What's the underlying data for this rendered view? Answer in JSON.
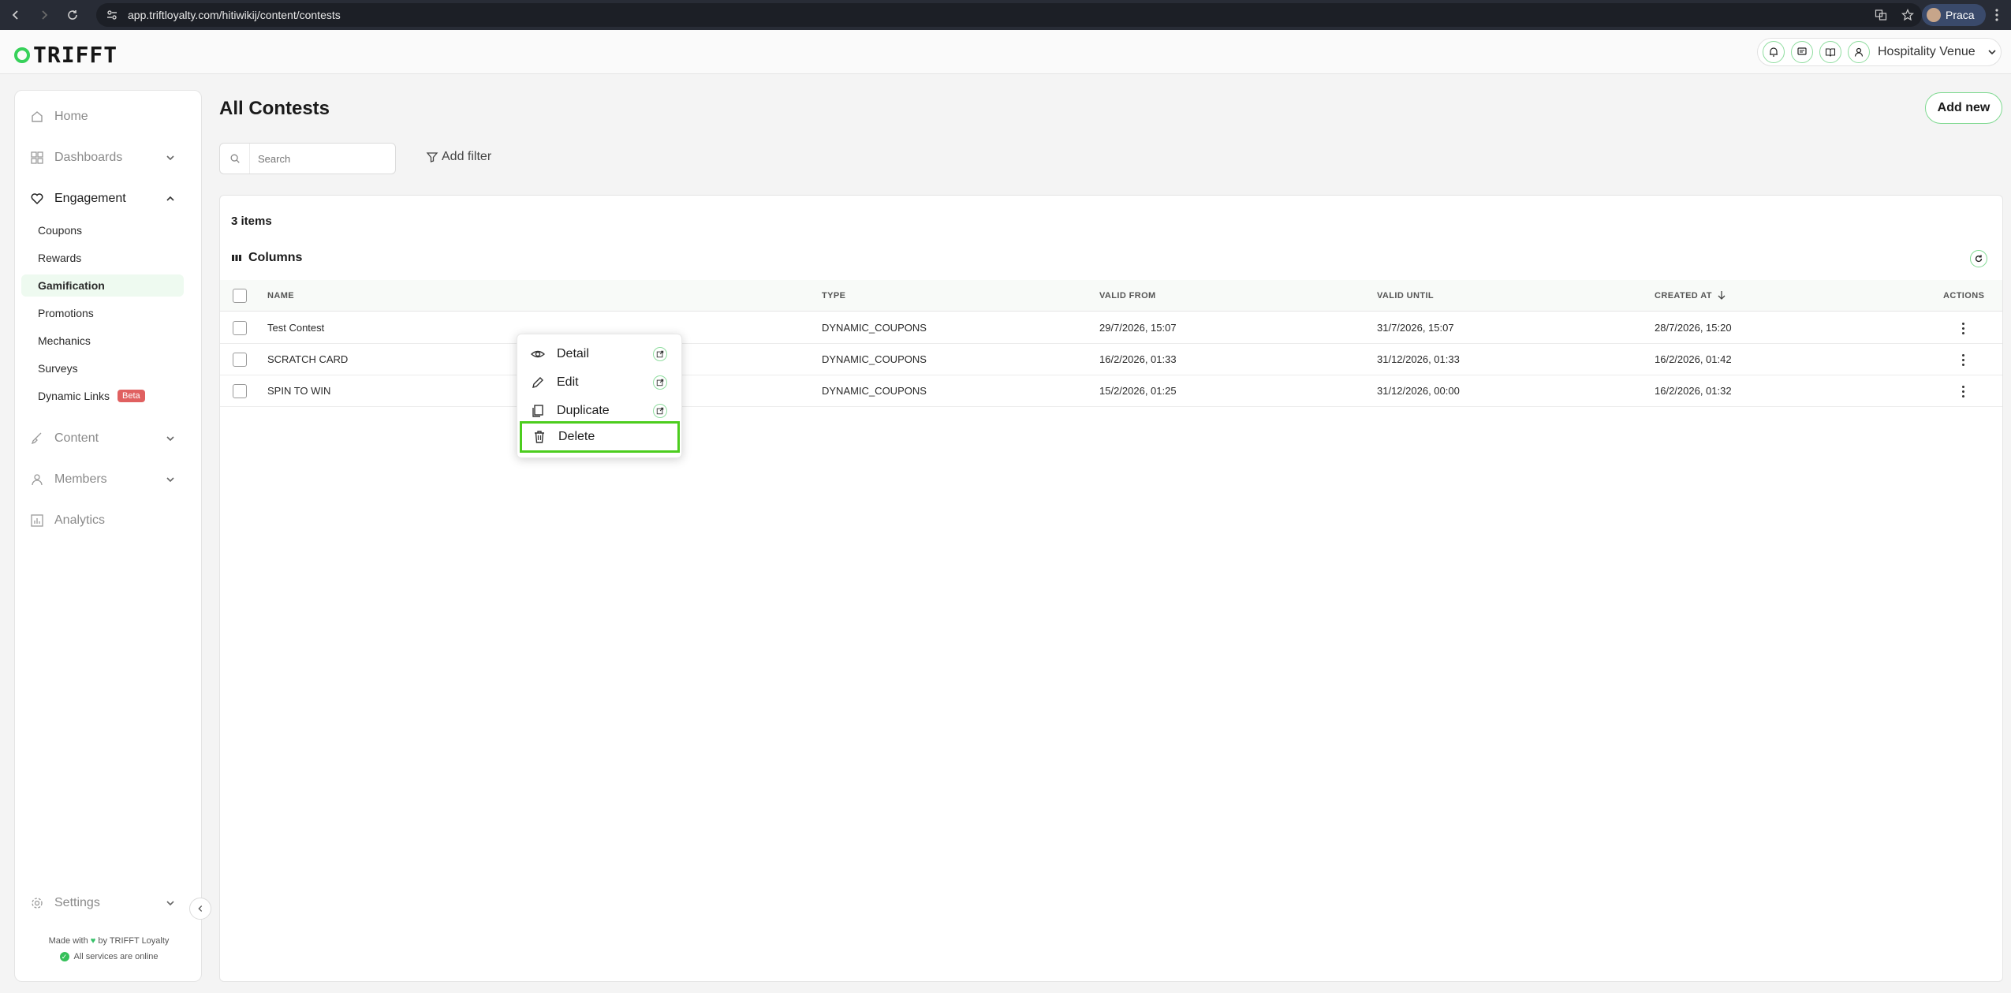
{
  "browser": {
    "url": "app.triftloyalty.com/hitiwikij/content/contests",
    "profile_name": "Praca"
  },
  "header": {
    "logo_text": "TRIFFT",
    "venue": "Hospitality Venue"
  },
  "sidebar": {
    "items": [
      {
        "label": "Home",
        "icon": "home-icon"
      },
      {
        "label": "Dashboards",
        "icon": "dashboard-icon"
      },
      {
        "label": "Engagement",
        "icon": "heart-icon"
      },
      {
        "label": "Content",
        "icon": "brush-icon"
      },
      {
        "label": "Members",
        "icon": "user-icon"
      },
      {
        "label": "Analytics",
        "icon": "chart-icon"
      }
    ],
    "engagement_children": [
      {
        "label": "Coupons"
      },
      {
        "label": "Rewards"
      },
      {
        "label": "Gamification"
      },
      {
        "label": "Promotions"
      },
      {
        "label": "Mechanics"
      },
      {
        "label": "Surveys"
      },
      {
        "label": "Dynamic Links",
        "badge": "Beta"
      }
    ],
    "settings_label": "Settings",
    "footer_made_with": "Made with",
    "footer_by": "by TRIFFT Loyalty",
    "footer_status": "All services are online"
  },
  "main": {
    "title": "All Contests",
    "add_new_label": "Add new",
    "search_placeholder": "Search",
    "add_filter_label": "Add filter",
    "items_count": "3 items",
    "columns_label": "Columns",
    "columns": {
      "name": "NAME",
      "type": "TYPE",
      "valid_from": "VALID FROM",
      "valid_until": "VALID UNTIL",
      "created_at": "CREATED AT",
      "actions": "ACTIONS"
    },
    "rows": [
      {
        "name": "Test Contest",
        "type": "DYNAMIC_COUPONS",
        "valid_from": "29/7/2026, 15:07",
        "valid_until": "31/7/2026, 15:07",
        "created_at": "28/7/2026, 15:20"
      },
      {
        "name": "SCRATCH CARD",
        "type": "DYNAMIC_COUPONS",
        "valid_from": "16/2/2026, 01:33",
        "valid_until": "31/12/2026, 01:33",
        "created_at": "16/2/2026, 01:42"
      },
      {
        "name": "SPIN TO WIN",
        "type": "DYNAMIC_COUPONS",
        "valid_from": "15/2/2026, 01:25",
        "valid_until": "31/12/2026, 00:00",
        "created_at": "16/2/2026, 01:32"
      }
    ]
  },
  "context_menu": {
    "items": [
      {
        "label": "Detail",
        "icon": "eye-icon"
      },
      {
        "label": "Edit",
        "icon": "pencil-icon"
      },
      {
        "label": "Duplicate",
        "icon": "copy-icon"
      },
      {
        "label": "Delete",
        "icon": "trash-icon"
      }
    ]
  },
  "colors": {
    "accent_green": "#37d15a",
    "highlight_border": "#4ccd1e",
    "beta_badge": "#e06060"
  }
}
